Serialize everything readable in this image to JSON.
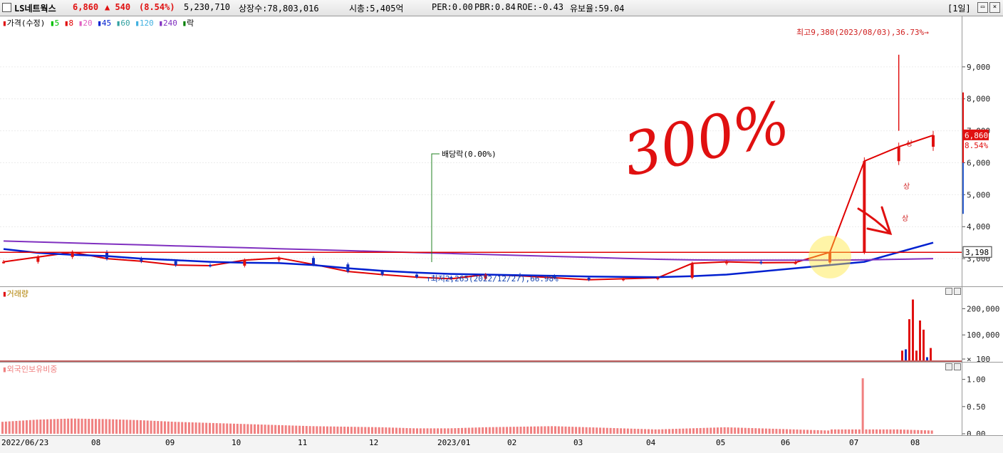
{
  "header": {
    "name": "LS네트웍스",
    "price": "6,860",
    "change": "▲ 540",
    "change_pct": "(8.54%)",
    "volume": "5,230,710",
    "listed": "상장수:78,803,016",
    "mktcap": "시총:5,405억",
    "per": "PER:0.00",
    "pbr": "PBR:0.84",
    "roe": "ROE:-0.43",
    "retention": "유보율:59.04",
    "period": "[1일]"
  },
  "colors": {
    "up": "#e01010",
    "down": "#1030c0",
    "ma5": "#00c000",
    "ma8": "#e00000",
    "ma20": "#e060c0",
    "ma45": "#0020d0",
    "ma60": "#30a0a0",
    "ma120": "#40b0e0",
    "ma240": "#8030c0",
    "hline": "#e00000",
    "volume": "#e01010",
    "foreign": "#f08080"
  },
  "price_pane": {
    "legend": {
      "title": "가격(수정)",
      "ma": [
        {
          "label": "5",
          "color": "#00c000"
        },
        {
          "label": "8",
          "color": "#e00000"
        },
        {
          "label": "20",
          "color": "#e060c0"
        },
        {
          "label": "45",
          "color": "#0020d0"
        },
        {
          "label": "60",
          "color": "#30a0a0"
        },
        {
          "label": "120",
          "color": "#40b0e0"
        },
        {
          "label": "240",
          "color": "#8030c0"
        }
      ],
      "extra": "락"
    },
    "annotations": {
      "high": "최고9,380(2023/08/03),36.73%",
      "low": "최저2,265(2022/12/27),66.98%",
      "dividend": "배당락(0.00%)",
      "up1": "상",
      "up2": "상",
      "up3": "상"
    },
    "handwriting": "300%",
    "hline_label": "3,198",
    "last_price_label": "6,860",
    "last_pct_label": "8.54%"
  },
  "volume_pane": {
    "title": "거래량"
  },
  "foreign_pane": {
    "title": "외국인보유비중"
  },
  "chart_data": [
    {
      "type": "candlestick",
      "title": "가격(수정)",
      "y_ticks": [
        "3,000",
        "4,000",
        "5,000",
        "6,000",
        "7,000",
        "8,000",
        "9,000"
      ],
      "ylim": [
        2200,
        10000
      ],
      "reference_line": 3198,
      "high": {
        "value": 9380,
        "date": "2023/08/03"
      },
      "low": {
        "value": 2265,
        "date": "2022/12/27"
      },
      "last_close": 6860,
      "series": [
        {
          "name": "가격(수정)",
          "values": [
            2900,
            3050,
            3200,
            3000,
            2920,
            2800,
            2780,
            2950,
            3020,
            2820,
            2600,
            2500,
            2420,
            2370,
            2500,
            2460,
            2400,
            2340,
            2370,
            2400,
            2850,
            2900,
            2870,
            2880,
            3200,
            6050,
            6500,
            6860
          ]
        },
        {
          "name": "45",
          "values": [
            3300,
            3180,
            3120,
            3080,
            3000,
            2950,
            2900,
            2870,
            2860,
            2800,
            2700,
            2620,
            2560,
            2520,
            2500,
            2480,
            2460,
            2440,
            2430,
            2420,
            2450,
            2500,
            2600,
            2700,
            2800,
            2900,
            3200,
            3500
          ]
        },
        {
          "name": "240",
          "values": [
            3550,
            3520,
            3490,
            3460,
            3430,
            3400,
            3370,
            3340,
            3310,
            3280,
            3250,
            3220,
            3190,
            3160,
            3130,
            3100,
            3070,
            3040,
            3010,
            2980,
            2960,
            2950,
            2950,
            2950,
            2950,
            2960,
            2980,
            3000
          ]
        }
      ],
      "x_ticks": [
        "2022/06/23",
        "08",
        "09",
        "10",
        "11",
        "12",
        "2023/01",
        "02",
        "03",
        "04",
        "05",
        "06",
        "07",
        "08"
      ]
    },
    {
      "type": "bar",
      "title": "거래량",
      "y_ticks": [
        "200,000",
        "100,000",
        "× 100"
      ],
      "ylim": [
        0,
        250000
      ],
      "values": [
        0,
        0,
        0,
        0,
        0,
        0,
        0,
        0,
        0,
        0,
        0,
        0,
        3000,
        0,
        0,
        0,
        0,
        0,
        0,
        0,
        0,
        0,
        0,
        0,
        0,
        0,
        0,
        0,
        0,
        0,
        40000,
        45000,
        160000,
        235000,
        40000,
        155000,
        120000,
        15000,
        50000
      ]
    },
    {
      "type": "bar",
      "title": "외국인보유비중",
      "y_ticks": [
        "1.00",
        "0.50",
        "0.00"
      ],
      "ylim": [
        0,
        1.1
      ],
      "values": [
        0.22,
        0.26,
        0.28,
        0.27,
        0.25,
        0.22,
        0.2,
        0.18,
        0.16,
        0.14,
        0.13,
        0.12,
        0.1,
        0.1,
        0.12,
        0.13,
        0.14,
        0.12,
        0.1,
        0.08,
        0.1,
        0.12,
        0.1,
        0.08,
        0.06,
        1.02,
        0.08,
        0.06
      ]
    }
  ]
}
